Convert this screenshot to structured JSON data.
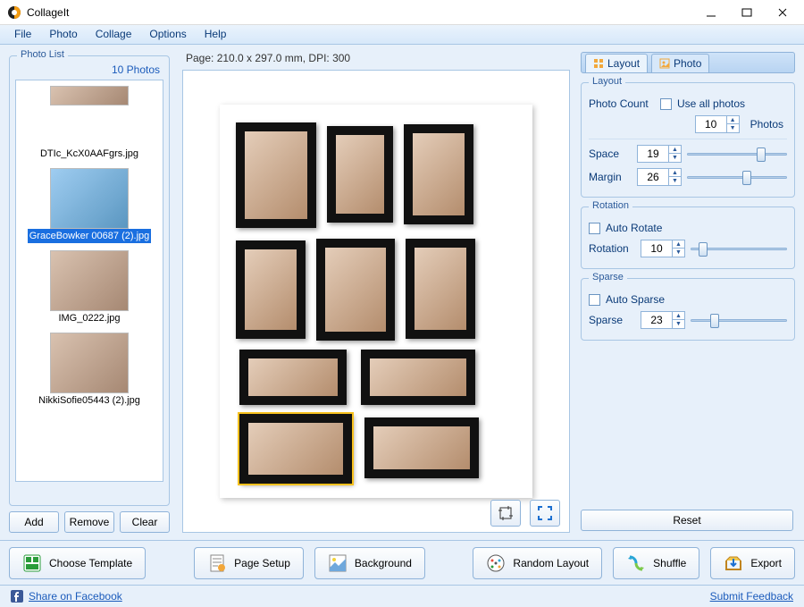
{
  "window": {
    "title": "CollageIt"
  },
  "menu": {
    "file": "File",
    "photo": "Photo",
    "collage": "Collage",
    "options": "Options",
    "help": "Help"
  },
  "photolist": {
    "legend": "Photo List",
    "count_label": "10 Photos",
    "items": [
      {
        "name": "DTIc_KcX0AAFgrs.jpg",
        "selected": false
      },
      {
        "name": "GraceBowker 00687 (2).jpg",
        "selected": true
      },
      {
        "name": "IMG_0222.jpg",
        "selected": false
      },
      {
        "name": "NikkiSofie05443 (2).jpg",
        "selected": false
      }
    ],
    "add": "Add",
    "remove": "Remove",
    "clear": "Clear"
  },
  "canvas": {
    "page_info": "Page: 210.0 x 297.0 mm, DPI: 300"
  },
  "tabs": {
    "layout": "Layout",
    "photo": "Photo"
  },
  "layout": {
    "legend": "Layout",
    "photo_count_label": "Photo Count",
    "use_all_label": "Use all photos",
    "photo_count": "10",
    "photos_suffix": "Photos",
    "space_label": "Space",
    "space": "19",
    "margin_label": "Margin",
    "margin": "26"
  },
  "rotation": {
    "legend": "Rotation",
    "auto_label": "Auto Rotate",
    "rotation_label": "Rotation",
    "value": "10"
  },
  "sparse": {
    "legend": "Sparse",
    "auto_label": "Auto Sparse",
    "sparse_label": "Sparse",
    "value": "23"
  },
  "reset": "Reset",
  "toolbar": {
    "choose_template": "Choose Template",
    "page_setup": "Page Setup",
    "background": "Background",
    "random_layout": "Random Layout",
    "shuffle": "Shuffle",
    "export": "Export"
  },
  "footer": {
    "share": "Share on Facebook",
    "feedback": "Submit Feedback"
  }
}
